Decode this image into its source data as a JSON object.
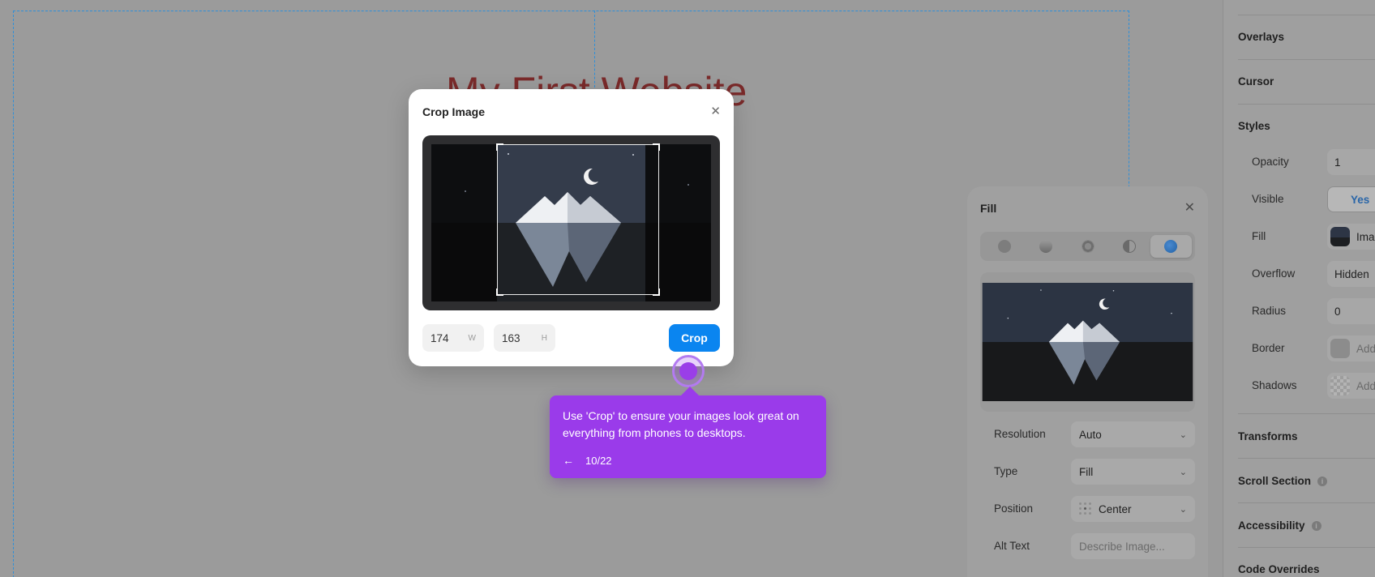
{
  "canvas": {
    "site_title": "My First Website"
  },
  "properties": {
    "sections": {
      "overlays": "Overlays",
      "cursor": "Cursor",
      "styles": "Styles",
      "transforms": "Transforms",
      "scroll_section": "Scroll Section",
      "accessibility": "Accessibility",
      "code_overrides": "Code Overrides"
    },
    "styles": {
      "opacity_label": "Opacity",
      "opacity_value": "1",
      "visible_label": "Visible",
      "visible_value": "Yes",
      "fill_label": "Fill",
      "fill_value": "Ima",
      "overflow_label": "Overflow",
      "overflow_value": "Hidden",
      "radius_label": "Radius",
      "radius_value": "0",
      "border_label": "Border",
      "border_value": "Add",
      "shadows_label": "Shadows",
      "shadows_value": "Add"
    }
  },
  "fill_panel": {
    "title": "Fill",
    "close_icon": "close-icon",
    "tabs": [
      "solid-color",
      "linear-gradient",
      "radial-gradient",
      "conic-gradient",
      "image"
    ],
    "active_tab": "image",
    "resolution_label": "Resolution",
    "resolution_value": "Auto",
    "type_label": "Type",
    "type_value": "Fill",
    "position_label": "Position",
    "position_value": "Center",
    "alt_text_label": "Alt Text",
    "alt_text_placeholder": "Describe Image..."
  },
  "crop_modal": {
    "title": "Crop Image",
    "close_icon": "close-icon",
    "width_value": "174",
    "width_unit": "W",
    "height_value": "163",
    "height_unit": "H",
    "crop_button": "Crop"
  },
  "tour": {
    "tooltip_text": "Use 'Crop' to ensure your images look great on everything from phones to desktops.",
    "step": "10/22",
    "back_icon": "arrow-left-icon"
  },
  "colors": {
    "accent_blue": "#0a85f0",
    "tour_purple": "#9a3bea",
    "frame_dash": "#2f8fd8"
  }
}
